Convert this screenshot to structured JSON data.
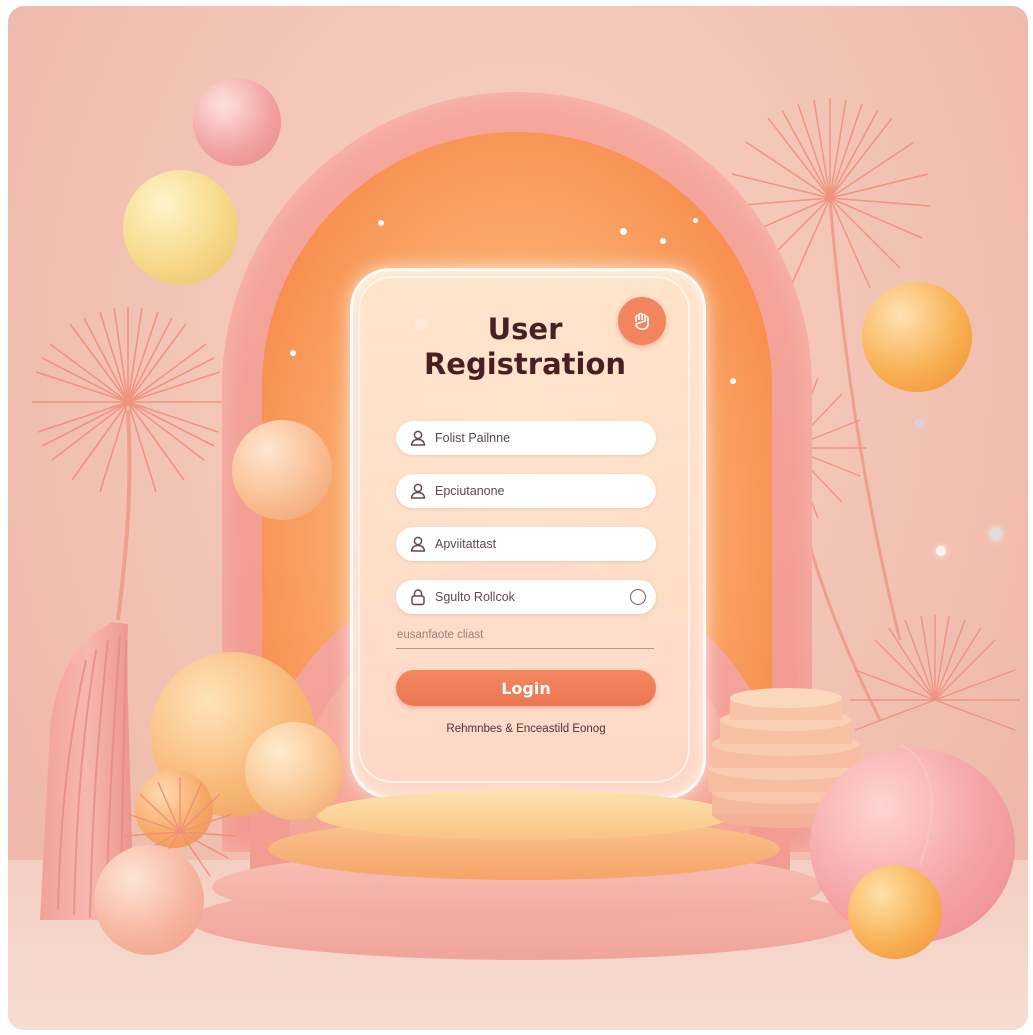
{
  "form": {
    "title_line1": "User",
    "title_line2": "Registration",
    "fields": [
      {
        "icon": "user-icon",
        "value": "Folist Pailnne"
      },
      {
        "icon": "user-icon",
        "value": "Epciutanone"
      },
      {
        "icon": "user-icon",
        "value": "Apviitattast"
      },
      {
        "icon": "lock-icon",
        "value": "Sgulto Rollcok"
      }
    ],
    "underline_label": "eusanfaote cliast",
    "login_label": "Login",
    "footer": "Rehmnbes & Enceastild Eonog"
  },
  "colors": {
    "accent": "#ee7b55",
    "title": "#4a1f22",
    "arch_outer": "#f4a199",
    "arch_inner": "#f78d4d",
    "background": "#f2c2b3"
  }
}
